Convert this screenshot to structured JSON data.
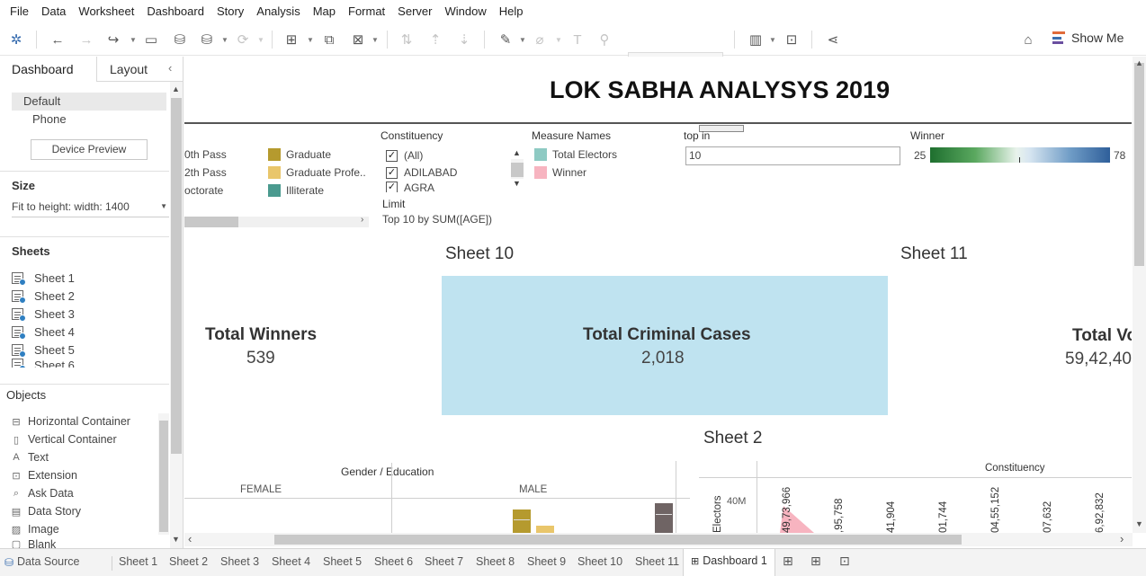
{
  "menu": [
    "File",
    "Data",
    "Worksheet",
    "Dashboard",
    "Story",
    "Analysis",
    "Map",
    "Format",
    "Server",
    "Window",
    "Help"
  ],
  "toolbar": {
    "show_me_label": "Show Me"
  },
  "left_pane": {
    "tabs": {
      "dashboard": "Dashboard",
      "layout": "Layout"
    },
    "devices": [
      "Default",
      "Phone"
    ],
    "device_preview_label": "Device Preview",
    "size_title": "Size",
    "size_value": "Fit to height: width: 1400",
    "sheets_title": "Sheets",
    "sheets": [
      "Sheet 1",
      "Sheet 2",
      "Sheet 3",
      "Sheet 4",
      "Sheet 5",
      "Sheet 6"
    ],
    "objects_title": "Objects",
    "objects": [
      "Horizontal Container",
      "Vertical Container",
      "Text",
      "Extension",
      "Ask Data",
      "Data Story",
      "Image",
      "Blank"
    ]
  },
  "dashboard": {
    "title": "LOK SABHA ANALYSYS 2019",
    "education_legend": [
      "0th Pass",
      "2th Pass",
      "octorate",
      "Graduate",
      "Graduate Profe..",
      "Illiterate"
    ],
    "education_colors": {
      "graduate": "#b59a2e",
      "graduate_prof": "#e9c66b",
      "illiterate": "#4a9a8f"
    },
    "constituency_filter": {
      "title": "Constituency",
      "items": [
        "(All)",
        "ADILABAD",
        "AGRA"
      ]
    },
    "limit": {
      "title": "Limit",
      "value": "Top 10 by SUM([AGE])"
    },
    "measure_names": {
      "title": "Measure Names",
      "items": [
        "Total Electors",
        "Winner"
      ],
      "colors": [
        "#8ecac3",
        "#f7b4c0"
      ]
    },
    "top_param": {
      "title": "top in",
      "value": "10"
    },
    "winner_legend": {
      "title": "Winner",
      "min": "25",
      "max": "78"
    },
    "sheet10_caption": "Sheet 10",
    "sheet11_caption": "Sheet 11",
    "sheet2_caption": "Sheet 2",
    "total_winners": {
      "label": "Total Winners",
      "value": "539"
    },
    "total_criminal": {
      "label": "Total Criminal Cases",
      "value": "2,018"
    },
    "total_votes": {
      "label": "Total Vo",
      "value": "59,42,40"
    },
    "gender_chart": {
      "title": "Gender / Education",
      "headers": [
        "FEMALE",
        "MALE"
      ]
    },
    "sheet2_chart": {
      "title": "Constituency",
      "y_axis": "Electors",
      "y_tick": "40M",
      "values": [
        "49,73,966",
        ",95,758",
        "41,904",
        "01,744",
        "04,55,152",
        "07,632",
        "6,92,832"
      ]
    }
  },
  "bottom_tabs": {
    "data_source": "Data Source",
    "sheets": [
      "Sheet 1",
      "Sheet 2",
      "Sheet 3",
      "Sheet 4",
      "Sheet 5",
      "Sheet 6",
      "Sheet 7",
      "Sheet 8",
      "Sheet 9",
      "Sheet 10",
      "Sheet 11"
    ],
    "active": "Dashboard 1"
  }
}
